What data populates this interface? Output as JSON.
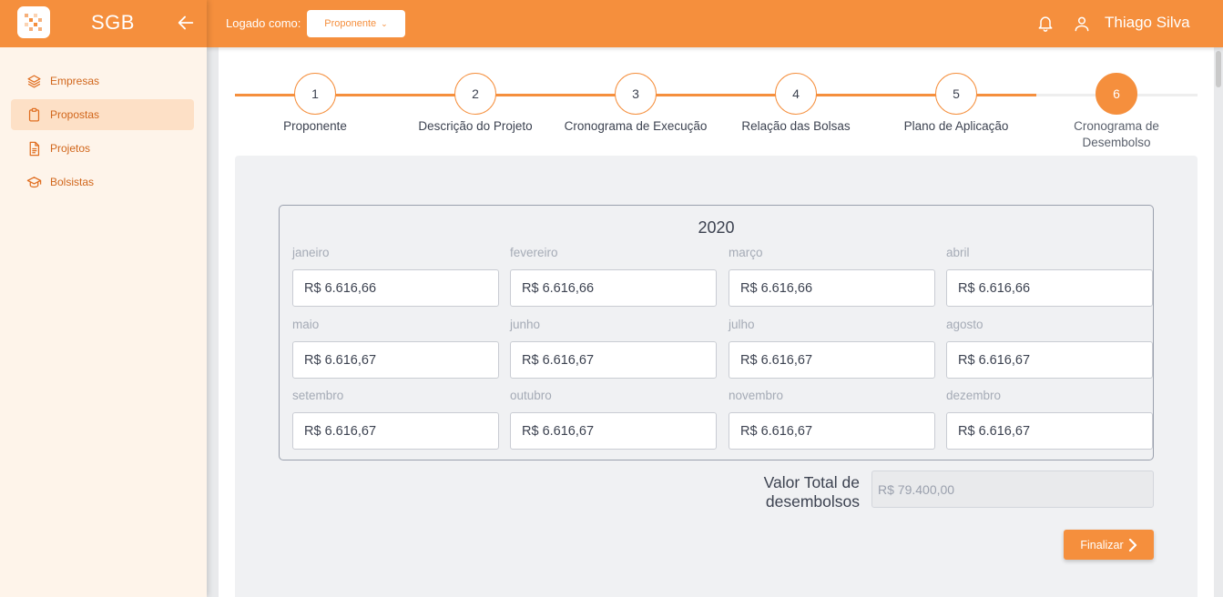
{
  "app": {
    "name": "SGB"
  },
  "sidebar": {
    "items": [
      {
        "label": "Empresas",
        "icon": "layers-icon"
      },
      {
        "label": "Propostas",
        "icon": "clipboard-icon",
        "active": true
      },
      {
        "label": "Projetos",
        "icon": "document-icon"
      },
      {
        "label": "Bolsistas",
        "icon": "graduation-cap-icon"
      }
    ]
  },
  "topbar": {
    "logged_label": "Logado como:",
    "role": "Proponente",
    "user_name": "Thiago Silva"
  },
  "stepper": {
    "current": 6,
    "steps": [
      {
        "number": "1",
        "label": "Proponente"
      },
      {
        "number": "2",
        "label": "Descrição do Projeto"
      },
      {
        "number": "3",
        "label": "Cronograma de Execução"
      },
      {
        "number": "4",
        "label": "Relação das Bolsas"
      },
      {
        "number": "5",
        "label": "Plano de Aplicação"
      },
      {
        "number": "6",
        "label": "Cronograma de Desembolso"
      }
    ]
  },
  "schedule": {
    "year": "2020",
    "months": [
      {
        "label": "janeiro",
        "value": "R$ 6.616,66"
      },
      {
        "label": "fevereiro",
        "value": "R$ 6.616,66"
      },
      {
        "label": "março",
        "value": "R$ 6.616,66"
      },
      {
        "label": "abril",
        "value": "R$ 6.616,66"
      },
      {
        "label": "maio",
        "value": "R$ 6.616,67"
      },
      {
        "label": "junho",
        "value": "R$ 6.616,67"
      },
      {
        "label": "julho",
        "value": "R$ 6.616,67"
      },
      {
        "label": "agosto",
        "value": "R$ 6.616,67"
      },
      {
        "label": "setembro",
        "value": "R$ 6.616,67"
      },
      {
        "label": "outubro",
        "value": "R$ 6.616,67"
      },
      {
        "label": "novembro",
        "value": "R$ 6.616,67"
      },
      {
        "label": "dezembro",
        "value": "R$ 6.616,67"
      }
    ]
  },
  "total": {
    "label": "Valor Total de desembolsos",
    "value": "R$ 79.400,00"
  },
  "actions": {
    "finish_label": "Finalizar"
  },
  "colors": {
    "accent": "#f58f3d",
    "sidebar_bg": "#fef4ea",
    "active_item_bg": "#fde0c6"
  }
}
